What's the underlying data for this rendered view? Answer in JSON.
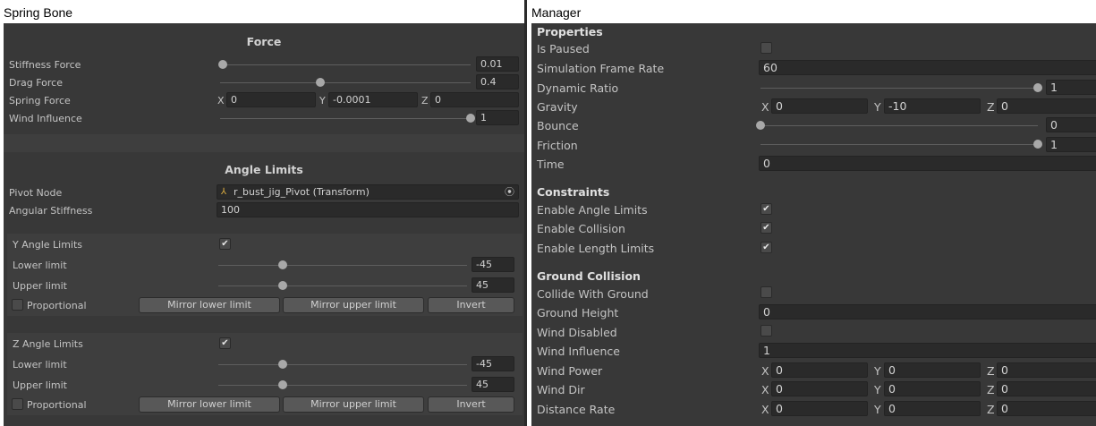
{
  "captions": {
    "left": "Spring Bone",
    "right": "Manager"
  },
  "spring_bone": {
    "force_header": "Force",
    "stiffness_force": {
      "label": "Stiffness Force",
      "value": "0.01",
      "level": 0.01
    },
    "drag_force": {
      "label": "Drag Force",
      "value": "0.4",
      "level": 0.4
    },
    "spring_force": {
      "label": "Spring Force",
      "x_label": "X",
      "x": "0",
      "y_label": "Y",
      "y": "-0.0001",
      "z_label": "Z",
      "z": "0"
    },
    "wind_influence": {
      "label": "Wind Influence",
      "value": "1",
      "level": 1
    },
    "angle_header": "Angle Limits",
    "pivot_node": {
      "label": "Pivot Node",
      "value": "r_bust_jig_Pivot (Transform)",
      "icon": "transform-icon"
    },
    "angular_stiffness": {
      "label": "Angular Stiffness",
      "value": "100"
    },
    "y_limits": {
      "title": "Y Angle Limits",
      "checked": true,
      "lower_label": "Lower limit",
      "lower": "-45",
      "upper_label": "Upper limit",
      "upper": "45",
      "proportional": "Proportional",
      "mirror_lower": "Mirror lower limit",
      "mirror_upper": "Mirror upper limit",
      "invert": "Invert"
    },
    "z_limits": {
      "title": "Z Angle Limits",
      "checked": true,
      "lower_label": "Lower limit",
      "lower": "-45",
      "upper_label": "Upper limit",
      "upper": "45",
      "proportional": "Proportional",
      "mirror_lower": "Mirror lower limit",
      "mirror_upper": "Mirror upper limit",
      "invert": "Invert"
    }
  },
  "manager": {
    "properties_header": "Properties",
    "is_paused": {
      "label": "Is Paused",
      "checked": false
    },
    "sim_frame_rate": {
      "label": "Simulation Frame Rate",
      "value": "60"
    },
    "dynamic_ratio": {
      "label": "Dynamic Ratio",
      "value": "1",
      "level": 1
    },
    "gravity": {
      "label": "Gravity",
      "x_label": "X",
      "x": "0",
      "y_label": "Y",
      "y": "-10",
      "z_label": "Z",
      "z": "0"
    },
    "bounce": {
      "label": "Bounce",
      "value": "0",
      "level": 0
    },
    "friction": {
      "label": "Friction",
      "value": "1",
      "level": 1
    },
    "time": {
      "label": "Time",
      "value": "0"
    },
    "constraints_header": "Constraints",
    "enable_angle_limits": {
      "label": "Enable Angle Limits",
      "checked": true
    },
    "enable_collision": {
      "label": "Enable Collision",
      "checked": true
    },
    "enable_length_limits": {
      "label": "Enable Length Limits",
      "checked": true
    },
    "ground_header": "Ground Collision",
    "collide_with_ground": {
      "label": "Collide With Ground",
      "checked": false
    },
    "ground_height": {
      "label": "Ground Height",
      "value": "0"
    },
    "wind_disabled": {
      "label": "Wind Disabled",
      "checked": false
    },
    "wind_influence": {
      "label": "Wind Influence",
      "value": "1"
    },
    "wind_power": {
      "label": "Wind Power",
      "x_label": "X",
      "x": "0",
      "y_label": "Y",
      "y": "0",
      "z_label": "Z",
      "z": "0"
    },
    "wind_dir": {
      "label": "Wind Dir",
      "x_label": "X",
      "x": "0",
      "y_label": "Y",
      "y": "0",
      "z_label": "Z",
      "z": "0"
    },
    "distance_rate": {
      "label": "Distance Rate",
      "x_label": "X",
      "x": "0",
      "y_label": "Y",
      "y": "0",
      "z_label": "Z",
      "z": "0"
    }
  }
}
